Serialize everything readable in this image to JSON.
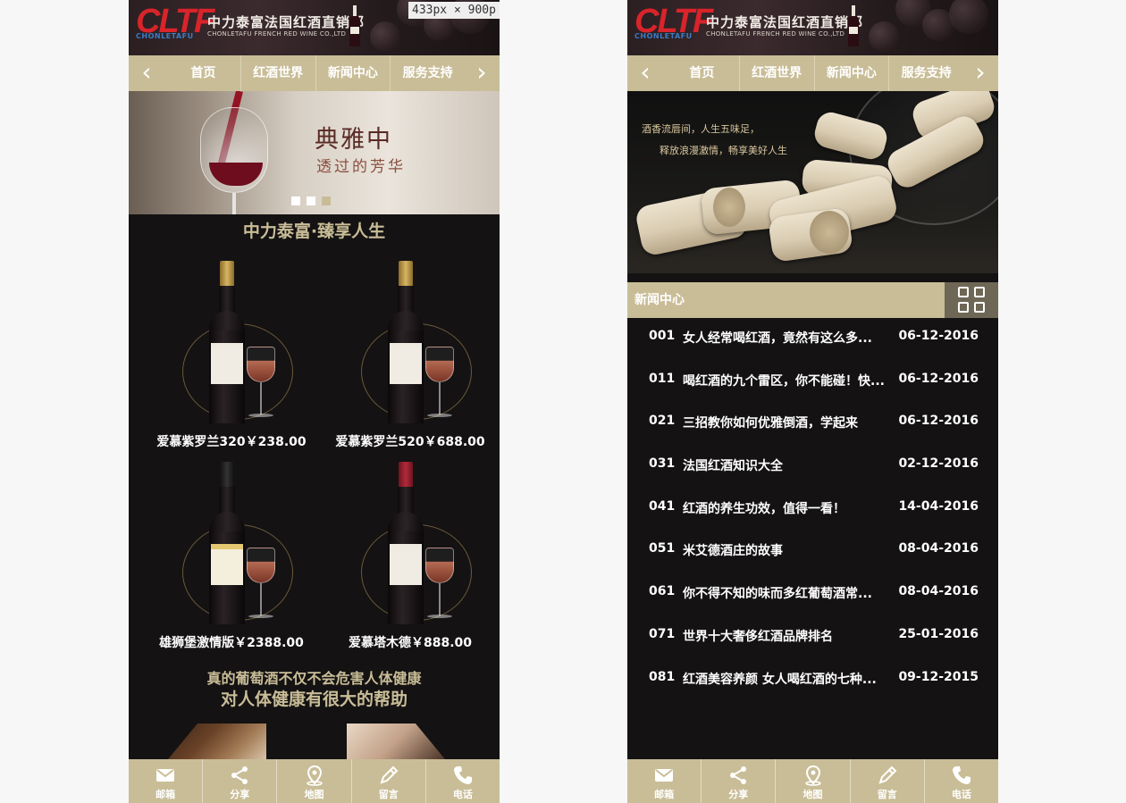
{
  "header": {
    "logo_mark": "CLTF",
    "logo_sub": "CHONLETAFU",
    "brand_cn": "中力泰富法国红酒直销部",
    "brand_en": "CHONLETAFU FRENCH RED WINE CO.,LTD",
    "dimension_tag": "433px × 900p"
  },
  "nav": {
    "items": [
      "首页",
      "红酒世界",
      "新闻中心",
      "服务支持"
    ],
    "prev": "‹",
    "next": "›"
  },
  "banner_left": {
    "title": "典雅中",
    "subtitle": "透过的芳华",
    "slide_count": 3,
    "active_slide": 3
  },
  "banner_right": {
    "line1": "酒香流唇间，人生五味足，",
    "line2": "释放浪漫激情，畅享美好人生"
  },
  "slogan": "中力泰富·臻享人生",
  "products": [
    {
      "name": "爱慕紫罗兰320￥238.00"
    },
    {
      "name": "爱慕紫罗兰520￥688.00"
    },
    {
      "name": "雄狮堡激情版￥2388.00"
    },
    {
      "name": "爱慕塔木德￥888.00"
    }
  ],
  "tagline": {
    "line1": "真的葡萄酒不仅不会危害人体健康",
    "line2": "对人体健康有很大的帮助"
  },
  "news": {
    "title": "新闻中心",
    "items": [
      {
        "num": "001",
        "text": "女人经常喝红酒，竟然有这么多...",
        "date": "06-12-2016"
      },
      {
        "num": "011",
        "text": "喝红酒的九个雷区，你不能碰！快...",
        "date": "06-12-2016"
      },
      {
        "num": "021",
        "text": "三招教你如何优雅倒酒，学起来",
        "date": "06-12-2016"
      },
      {
        "num": "031",
        "text": "法国红酒知识大全",
        "date": "02-12-2016"
      },
      {
        "num": "041",
        "text": "红酒的养生功效，值得一看！",
        "date": "14-04-2016"
      },
      {
        "num": "051",
        "text": "米艾德酒庄的故事",
        "date": "08-04-2016"
      },
      {
        "num": "061",
        "text": "你不得不知的味而多红葡萄酒常...",
        "date": "08-04-2016"
      },
      {
        "num": "071",
        "text": "世界十大奢侈红酒品牌排名",
        "date": "25-01-2016"
      },
      {
        "num": "081",
        "text": "红酒美容养颜 女人喝红酒的七种...",
        "date": "09-12-2015"
      }
    ]
  },
  "footer": {
    "items": [
      {
        "label": "邮箱",
        "icon": "mail-icon"
      },
      {
        "label": "分享",
        "icon": "share-icon"
      },
      {
        "label": "地图",
        "icon": "map-pin-icon"
      },
      {
        "label": "留言",
        "icon": "pencil-icon"
      },
      {
        "label": "电话",
        "icon": "phone-icon"
      }
    ]
  },
  "colors": {
    "accent": "#c9bd97",
    "background": "#141213",
    "news_grid_button": "#6e6756"
  }
}
